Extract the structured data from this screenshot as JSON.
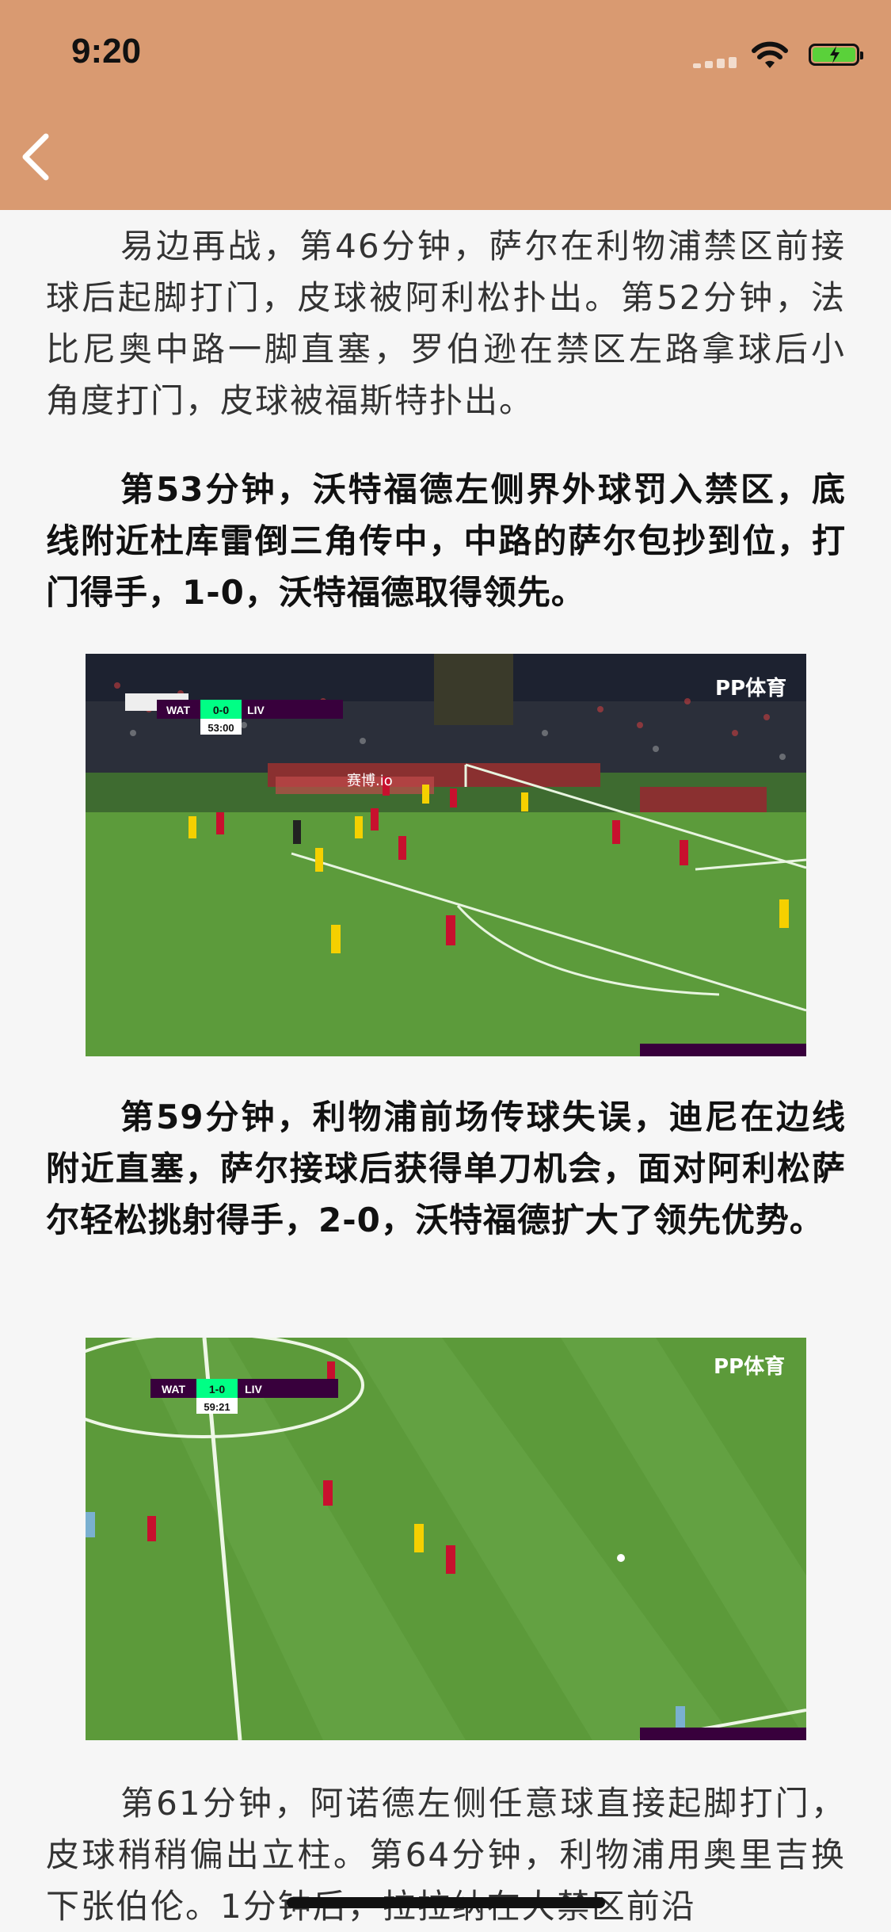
{
  "status_bar": {
    "time": "9:20"
  },
  "article": {
    "p1": "易边再战，第46分钟，萨尔在利物浦禁区前接球后起脚打门，皮球被阿利松扑出。第52分钟，法比尼奥中路一脚直塞，罗伯逊在禁区左路拿球后小角度打门，皮球被福斯特扑出。",
    "p2": "第53分钟，沃特福德左侧界外球罚入禁区，底线附近杜库雷倒三角传中，中路的萨尔包抄到位，打门得手，1-0，沃特福德取得领先。",
    "p3": "第59分钟，利物浦前场传球失误，迪尼在边线附近直塞，萨尔接球后获得单刀机会，面对阿利松萨尔轻松挑射得手，2-0，沃特福德扩大了领先优势。",
    "p4": "第61分钟，阿诺德左侧任意球直接起脚打门，皮球稍稍偏出立柱。第64分钟，利物浦用奥里吉换下张伯伦。1分钟后，拉拉纳在大禁区前沿"
  },
  "image1": {
    "home": "WAT",
    "score": "0-0",
    "away": "LIV",
    "clock": "53:00",
    "broadcaster": "PP体育",
    "ad": "赛博.io"
  },
  "image2": {
    "home": "WAT",
    "score": "1-0",
    "away": "LIV",
    "clock": "59:21",
    "broadcaster": "PP体育"
  },
  "colors": {
    "header": "#d99a71",
    "pitch": "#5a9a3a",
    "liv": "#c8102e",
    "wat": "#f5d000"
  }
}
